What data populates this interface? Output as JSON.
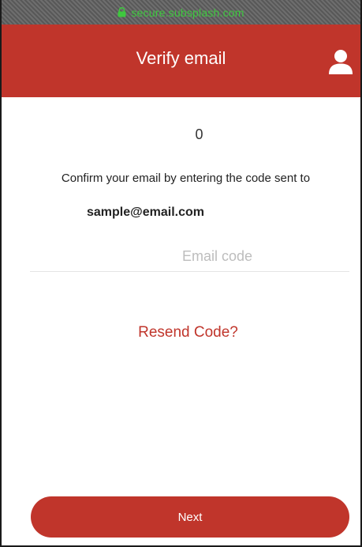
{
  "browser": {
    "url": "secure.subsplash.com"
  },
  "header": {
    "title": "Verify email",
    "icon": "user-icon"
  },
  "content": {
    "counter": "0",
    "instruction": "Confirm your email by entering the code sent to",
    "email": "sample@email.com",
    "code_input": {
      "value": "",
      "placeholder": "Email code"
    },
    "resend_label": "Resend Code?"
  },
  "footer": {
    "next_label": "Next"
  },
  "colors": {
    "brand": "#c0352b",
    "url_secure": "#3ec83e",
    "placeholder": "#bdbdbd"
  }
}
